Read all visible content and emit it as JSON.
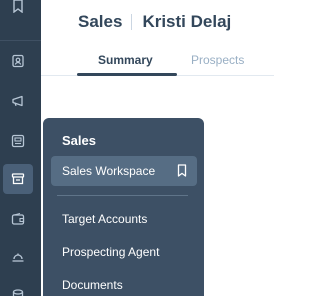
{
  "header": {
    "hub": "Sales",
    "user": "Kristi Delaj"
  },
  "tabs": [
    {
      "label": "Summary",
      "active": true
    },
    {
      "label": "Prospects",
      "active": false
    }
  ],
  "rail": {
    "icons": [
      "bookmark-icon",
      "contacts-icon",
      "megaphone-icon",
      "content-icon",
      "sales-icon",
      "commerce-icon",
      "service-icon",
      "data-icon"
    ],
    "active": "sales-icon"
  },
  "flyout": {
    "title": "Sales",
    "items": [
      {
        "label": "Sales Workspace",
        "active": true,
        "bookmark_icon": "bookmark-icon"
      },
      {
        "label": "Target Accounts"
      },
      {
        "label": "Prospecting Agent"
      },
      {
        "label": "Documents"
      }
    ]
  },
  "colors": {
    "rail_bg": "#2e3f50",
    "flyout_bg": "#3d5065",
    "active_item_bg": "#566d84",
    "text_dark": "#33475b",
    "text_muted": "#99afc4"
  }
}
